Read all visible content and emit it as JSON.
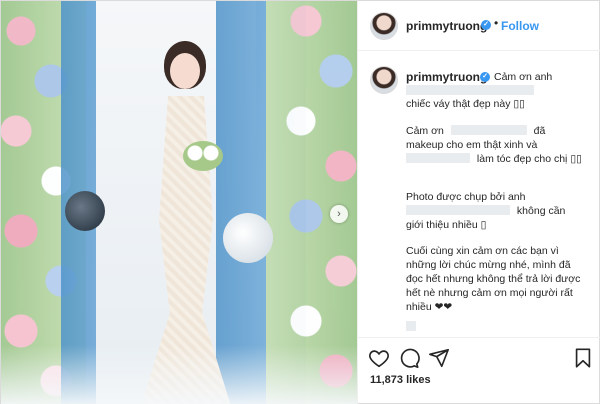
{
  "post": {
    "username": "primmytruong",
    "follow_label": "Follow",
    "separator": "•",
    "likes": "11,873 likes"
  },
  "caption": {
    "line1": "Cảm ơn anh",
    "line2_end": "chiếc váy thật đẹp này",
    "para2_a": "Cảm ơn",
    "para2_b": "đã",
    "para2_c": "makeup cho em thật xinh và",
    "para2_d": "làm tóc đẹp cho chị",
    "para3_a": "Photo được chụp bởi anh",
    "para3_b": "không cần",
    "para3_c": "giới thiệu nhiều",
    "para4_a": "Cuối cùng xin cảm ơn các bạn vì",
    "para4_b": "những lời chúc mừng nhé, mình đã",
    "para4_c": "đọc hết nhưng không thể trả lời được",
    "para4_d": "hết nè nhưng cảm ơn mọi người rất",
    "para4_e": "nhiều",
    "hearts": "❤❤",
    "emoji_box": "▯▯",
    "emoji_single": "▯"
  },
  "icons": {
    "like": "heart-icon",
    "comment": "comment-icon",
    "share": "share-icon",
    "save": "bookmark-icon",
    "next": "chevron-right-icon",
    "verified": "verified-badge-icon"
  },
  "colors": {
    "accent": "#3897f0",
    "text": "#262626",
    "border": "#dbdbdb"
  }
}
